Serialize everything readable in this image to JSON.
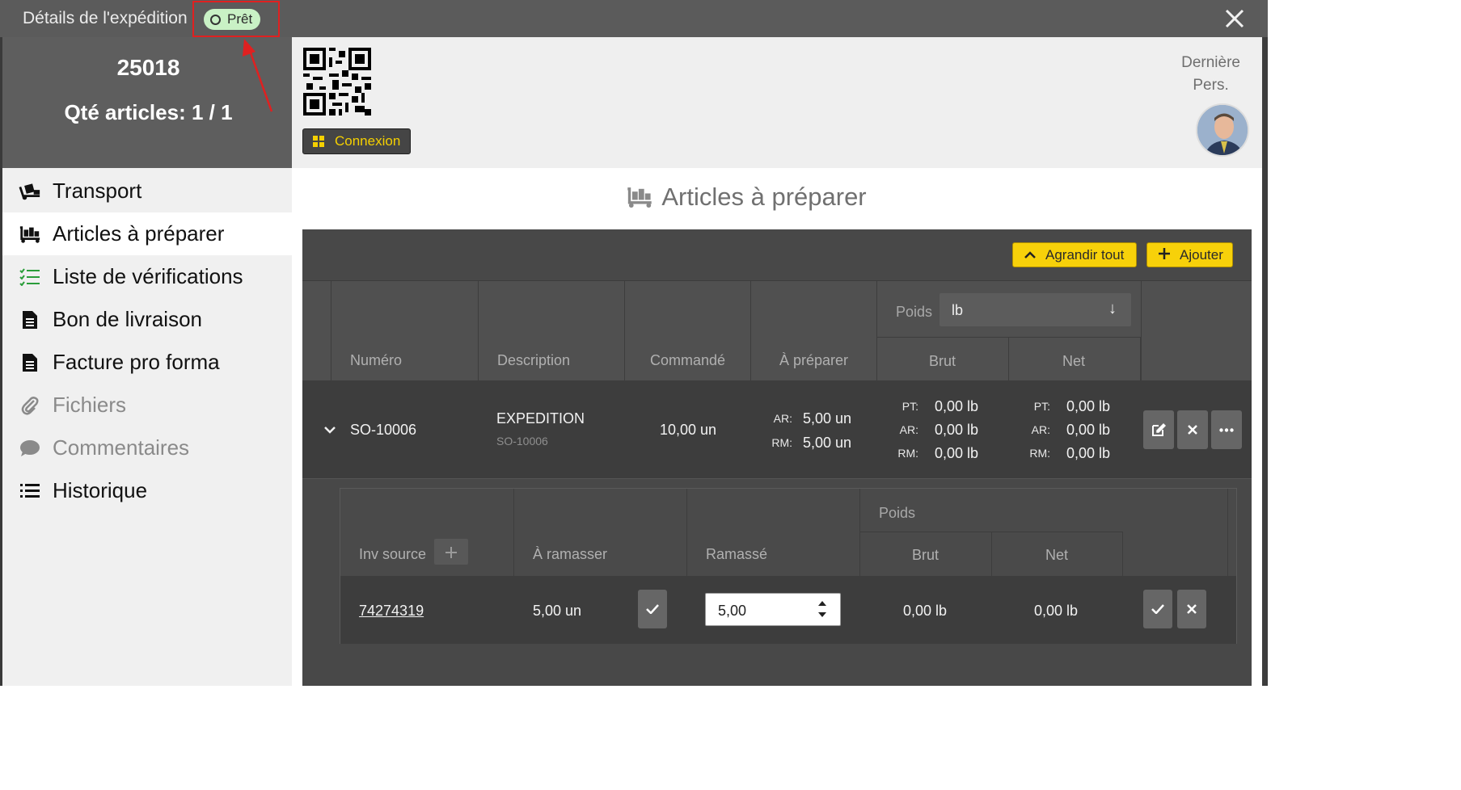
{
  "window": {
    "title": "Détails de l'expédition",
    "status": "Prêt"
  },
  "summary": {
    "order_number": "25018",
    "quantity": "Qté articles: 1 / 1"
  },
  "info": {
    "connect_label": "Connexion",
    "last_person_line1": "Dernière",
    "last_person_line2": "Pers."
  },
  "sidebar": {
    "items": [
      {
        "label": "Transport"
      },
      {
        "label": "Articles à préparer"
      },
      {
        "label": "Liste de vérifications"
      },
      {
        "label": "Bon de livraison"
      },
      {
        "label": "Facture pro forma"
      },
      {
        "label": "Fichiers"
      },
      {
        "label": "Commentaires"
      },
      {
        "label": "Historique"
      }
    ]
  },
  "main": {
    "section_title": "Articles à préparer",
    "expand_all_label": "Agrandir tout",
    "add_label": "Ajouter",
    "table": {
      "headers": {
        "number": "Numéro",
        "description": "Description",
        "ordered": "Commandé",
        "to_prepare": "À préparer",
        "weight": "Poids",
        "unit": "lb",
        "gross": "Brut",
        "net": "Net"
      },
      "row": {
        "number": "SO-10006",
        "description": "EXPEDITION",
        "description_sub": "SO-10006",
        "ordered": "10,00 un",
        "prep_ar_key": "AR:",
        "prep_ar_val": "5,00 un",
        "prep_rm_key": "RM:",
        "prep_rm_val": "5,00 un",
        "gross_pt_key": "PT:",
        "gross_pt_val": "0,00 lb",
        "gross_ar_key": "AR:",
        "gross_ar_val": "0,00 lb",
        "gross_rm_key": "RM:",
        "gross_rm_val": "0,00 lb",
        "net_pt_key": "PT:",
        "net_pt_val": "0,00 lb",
        "net_ar_key": "AR:",
        "net_ar_val": "0,00 lb",
        "net_rm_key": "RM:",
        "net_rm_val": "0,00 lb"
      }
    },
    "subtable": {
      "headers": {
        "inv_source": "Inv source",
        "to_pick": "À ramasser",
        "picked": "Ramassé",
        "weight": "Poids",
        "gross": "Brut",
        "net": "Net"
      },
      "row": {
        "inv_source": "74274319",
        "to_pick": "5,00 un",
        "picked": "5,00",
        "gross": "0,00 lb",
        "net": "0,00 lb"
      }
    }
  }
}
